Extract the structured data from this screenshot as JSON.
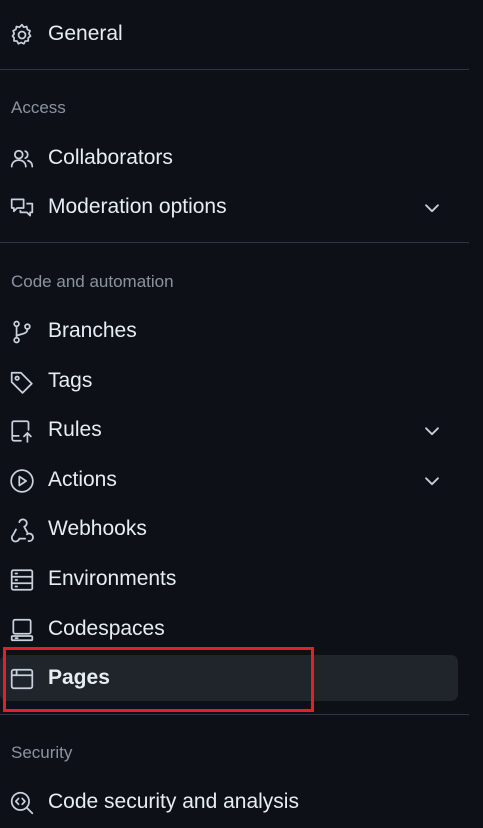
{
  "general": {
    "label": "General",
    "icon": "gear-icon"
  },
  "sections": {
    "access": {
      "heading": "Access",
      "items": [
        {
          "label": "Collaborators",
          "icon": "people-icon"
        },
        {
          "label": "Moderation options",
          "icon": "comment-discussion-icon",
          "expandable": true
        }
      ]
    },
    "code_automation": {
      "heading": "Code and automation",
      "items": [
        {
          "label": "Branches",
          "icon": "git-branch-icon"
        },
        {
          "label": "Tags",
          "icon": "tag-icon"
        },
        {
          "label": "Rules",
          "icon": "repo-push-icon",
          "expandable": true
        },
        {
          "label": "Actions",
          "icon": "play-icon",
          "expandable": true
        },
        {
          "label": "Webhooks",
          "icon": "webhook-icon"
        },
        {
          "label": "Environments",
          "icon": "server-icon"
        },
        {
          "label": "Codespaces",
          "icon": "codespaces-icon"
        },
        {
          "label": "Pages",
          "icon": "browser-icon",
          "selected": true
        }
      ]
    },
    "security": {
      "heading": "Security",
      "items": [
        {
          "label": "Code security and analysis",
          "icon": "codescan-icon"
        }
      ]
    }
  },
  "colors": {
    "background": "#0d1117",
    "text": "#e6edf3",
    "muted": "#8b949e",
    "divider": "#30363d",
    "selected_bg": "#20242b",
    "highlight": "#e0202a"
  }
}
